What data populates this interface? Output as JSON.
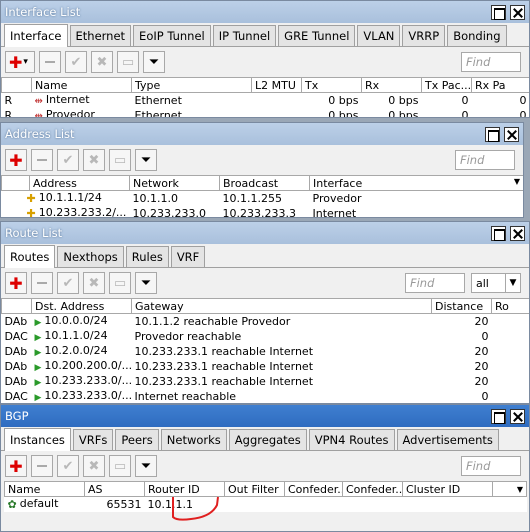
{
  "interface_list": {
    "title": "Interface List",
    "tabs": [
      "Interface",
      "Ethernet",
      "EoIP Tunnel",
      "IP Tunnel",
      "GRE Tunnel",
      "VLAN",
      "VRRP",
      "Bonding"
    ],
    "find_placeholder": "Find",
    "columns": [
      "",
      "Name",
      "Type",
      "L2 MTU",
      "Tx",
      "Rx",
      "Tx Pac...",
      "Rx Pa"
    ],
    "rows": [
      {
        "flag": "R",
        "name": "Internet",
        "type": "Ethernet",
        "l2mtu": "",
        "tx": "0 bps",
        "rx": "0 bps",
        "txp": "0",
        "rxp": "0"
      },
      {
        "flag": "R",
        "name": "Provedor",
        "type": "Ethernet",
        "l2mtu": "",
        "tx": "0 bps",
        "rx": "0 bps",
        "txp": "0",
        "rxp": "0"
      }
    ]
  },
  "address_list": {
    "title": "Address List",
    "find_placeholder": "Find",
    "columns": [
      "",
      "Address",
      "Network",
      "Broadcast",
      "Interface"
    ],
    "rows": [
      {
        "address": "10.1.1.1/24",
        "network": "10.1.1.0",
        "broadcast": "10.1.1.255",
        "interface": "Provedor"
      },
      {
        "address": "10.233.233.2/...",
        "network": "10.233.233.0",
        "broadcast": "10.233.233.3",
        "interface": "Internet"
      }
    ]
  },
  "route_list": {
    "title": "Route List",
    "tabs": [
      "Routes",
      "Nexthops",
      "Rules",
      "VRF"
    ],
    "find_placeholder": "Find",
    "filter_value": "all",
    "columns": [
      "",
      "Dst. Address",
      "Gateway",
      "Distance",
      "Ro"
    ],
    "rows": [
      {
        "flags": "DAb",
        "dst": "10.0.0.0/24",
        "gateway": "10.1.1.2 reachable Provedor",
        "distance": "20"
      },
      {
        "flags": "DAC",
        "dst": "10.1.1.0/24",
        "gateway": "Provedor reachable",
        "distance": "0"
      },
      {
        "flags": "DAb",
        "dst": "10.2.0.0/24",
        "gateway": "10.233.233.1 reachable Internet",
        "distance": "20"
      },
      {
        "flags": "DAb",
        "dst": "10.200.200.0/...",
        "gateway": "10.233.233.1 reachable Internet",
        "distance": "20"
      },
      {
        "flags": "DAb",
        "dst": "10.233.233.0/...",
        "gateway": "10.233.233.1 reachable Internet",
        "distance": "20"
      },
      {
        "flags": "DAC",
        "dst": "10.233.233.0/...",
        "gateway": "Internet reachable",
        "distance": "0"
      }
    ]
  },
  "bgp": {
    "title": "BGP",
    "tabs": [
      "Instances",
      "VRFs",
      "Peers",
      "Networks",
      "Aggregates",
      "VPN4 Routes",
      "Advertisements"
    ],
    "find_placeholder": "Find",
    "columns": [
      "Name",
      "AS",
      "Router ID",
      "Out Filter",
      "Confeder...",
      "Confeder...",
      "Cluster ID"
    ],
    "rows": [
      {
        "name": "default",
        "as": "65531",
        "router_id": "10.1.1.1",
        "out_filter": "",
        "conf1": "",
        "conf2": "",
        "cluster_id": ""
      }
    ]
  },
  "annotation_color": "#e02020"
}
